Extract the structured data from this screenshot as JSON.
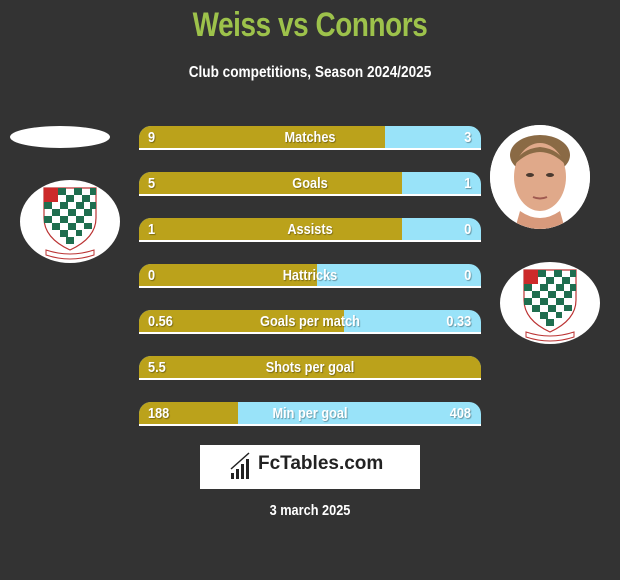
{
  "header": {
    "title": "Weiss vs Connors",
    "subtitle": "Club competitions, Season 2024/2025"
  },
  "colors": {
    "title": "#9dc24b",
    "left_bar": "#bba21b",
    "right_bar": "#99e3f9",
    "background": "#333333"
  },
  "players": {
    "left": {
      "name": "Weiss",
      "club_logo": "chesham-united-crest"
    },
    "right": {
      "name": "Connors",
      "photo": "player-photo",
      "club_logo": "chesham-united-crest"
    }
  },
  "stats": [
    {
      "label": "Matches",
      "left": "9",
      "right": "3",
      "left_share": 0.72
    },
    {
      "label": "Goals",
      "left": "5",
      "right": "1",
      "left_share": 0.77
    },
    {
      "label": "Assists",
      "left": "1",
      "right": "0",
      "left_share": 0.77
    },
    {
      "label": "Hattricks",
      "left": "0",
      "right": "0",
      "left_share": 0.52
    },
    {
      "label": "Goals per match",
      "left": "0.56",
      "right": "0.33",
      "left_share": 0.6
    },
    {
      "label": "Shots per goal",
      "left": "5.5",
      "right": "",
      "left_share": 1.0
    },
    {
      "label": "Min per goal",
      "left": "188",
      "right": "408",
      "left_share": 0.29
    }
  ],
  "footer": {
    "brand": "FcTables.com",
    "date": "3 march 2025"
  }
}
